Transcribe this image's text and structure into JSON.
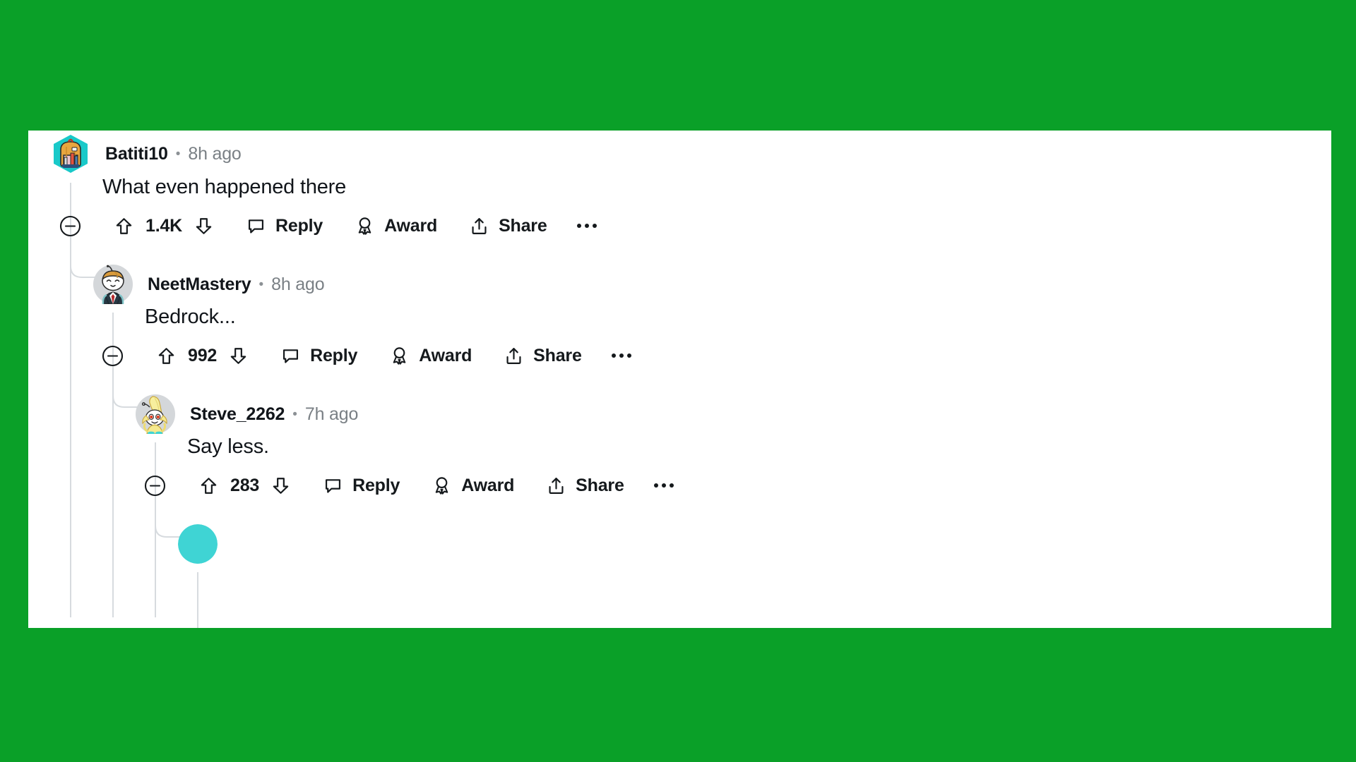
{
  "page": {
    "background_color": "#0aa028",
    "card_background": "#ffffff",
    "text_color": "#11151a",
    "muted_text_color": "#7a8085",
    "thread_line_color": "#d7dbdf"
  },
  "labels": {
    "separator_dot": "•",
    "reply": "Reply",
    "award": "Award",
    "share": "Share"
  },
  "comments": [
    {
      "id": "comment-1",
      "depth": 0,
      "username": "Batiti10",
      "timestamp": "8h ago",
      "body": "What even happened there",
      "vote_count": "1.4K",
      "avatar_type": "backpack-hex-avatar",
      "avatar_colors": {
        "background": "#18c7c7",
        "primary": "#e8a33d",
        "secondary": "#2f5e8c",
        "accent": "#e5533d"
      },
      "actions": {
        "collapse": "collapse-thread",
        "upvote": "upvote",
        "downvote": "downvote",
        "reply": "Reply",
        "award": "Award",
        "share": "Share",
        "more": "more-options"
      }
    },
    {
      "id": "comment-2",
      "depth": 1,
      "username": "NeetMastery",
      "timestamp": "8h ago",
      "body": "Bedrock...",
      "vote_count": "992",
      "avatar_type": "snoo-suit-avatar",
      "avatar_colors": {
        "background": "#d3d6d9",
        "hair": "#d99b3c",
        "suit": "#273843",
        "tie": "#b5292b",
        "skin": "#ffffff"
      },
      "actions": {
        "collapse": "collapse-thread",
        "upvote": "upvote",
        "downvote": "downvote",
        "reply": "Reply",
        "award": "Award",
        "share": "Share",
        "more": "more-options"
      }
    },
    {
      "id": "comment-3",
      "depth": 2,
      "username": "Steve_2262",
      "timestamp": "7h ago",
      "body": "Say less.",
      "vote_count": "283",
      "avatar_type": "snoo-banana-avatar",
      "avatar_colors": {
        "background": "#d3d6d9",
        "banana": "#f5e98f",
        "banana_dark": "#ebd95f",
        "eyes": "#e03c20",
        "shoes": "#3fd4d4"
      },
      "actions": {
        "collapse": "collapse-thread",
        "upvote": "upvote",
        "downvote": "downvote",
        "reply": "Reply",
        "award": "Award",
        "share": "Share",
        "more": "more-options"
      }
    }
  ],
  "partial_comment": {
    "id": "comment-4-partial",
    "avatar_type": "snoo-cyan-avatar",
    "avatar_color": "#3fd4d4"
  }
}
